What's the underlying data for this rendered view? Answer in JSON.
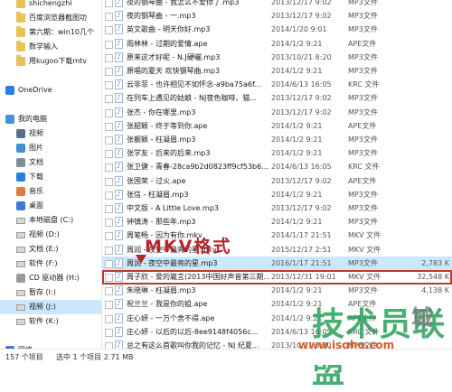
{
  "sidebar": {
    "items": [
      {
        "label": "shichengzhi",
        "kind": "folder",
        "indent": 1
      },
      {
        "label": "百度浏览器截图功",
        "kind": "folder",
        "indent": 1
      },
      {
        "label": "第六期：win10几个",
        "kind": "folder",
        "indent": 1
      },
      {
        "label": "数学输入",
        "kind": "folder",
        "indent": 1
      },
      {
        "label": "用kugoo下载mtv",
        "kind": "folder",
        "indent": 1
      },
      {
        "label": "",
        "kind": "spacer",
        "indent": 0
      },
      {
        "label": "OneDrive",
        "kind": "cloud",
        "indent": 0
      },
      {
        "label": "",
        "kind": "spacer",
        "indent": 0
      },
      {
        "label": "我的电脑",
        "kind": "pc",
        "indent": 0
      },
      {
        "label": "视频",
        "kind": "video",
        "indent": 1
      },
      {
        "label": "图片",
        "kind": "image",
        "indent": 1
      },
      {
        "label": "文档",
        "kind": "doc",
        "indent": 1
      },
      {
        "label": "下载",
        "kind": "download",
        "indent": 1
      },
      {
        "label": "音乐",
        "kind": "music",
        "indent": 1
      },
      {
        "label": "桌面",
        "kind": "desktop",
        "indent": 1
      },
      {
        "label": "本地磁盘 (C:)",
        "kind": "drive",
        "indent": 1
      },
      {
        "label": "视频 (D:)",
        "kind": "drive",
        "indent": 1
      },
      {
        "label": "文档 (E:)",
        "kind": "drive",
        "indent": 1
      },
      {
        "label": "软件 (F:)",
        "kind": "drive",
        "indent": 1
      },
      {
        "label": "CD 驱动器 (H:)",
        "kind": "cd",
        "indent": 1
      },
      {
        "label": "暂存 (I:)",
        "kind": "drive",
        "indent": 1
      },
      {
        "label": "视频 (J:)",
        "kind": "drive",
        "indent": 1,
        "selected": true
      },
      {
        "label": "软件 (K:)",
        "kind": "drive",
        "indent": 1
      },
      {
        "label": "",
        "kind": "spacer",
        "indent": 0
      },
      {
        "label": "网络",
        "kind": "network",
        "indent": 0
      }
    ]
  },
  "files": [
    {
      "name": "夜的钢琴曲 - 我怎么不爱你了.mp3",
      "date": "2013/12/17 9:02",
      "type": "MP3文件",
      "size": ""
    },
    {
      "name": "夜的钢琴曲 - 一.mp3",
      "date": "2013/12/17 9:02",
      "type": "MP3文件",
      "size": ""
    },
    {
      "name": "英文歌曲 - 明天你好.mp3",
      "date": "2014/1/20 9:01",
      "type": "MP3文件",
      "size": ""
    },
    {
      "name": "雨林林 - 过期的爱情.ape",
      "date": "2014/1/2 9:21",
      "type": "APE文件",
      "size": ""
    },
    {
      "name": "原来这才好呢 - N.J硬曬.mp3",
      "date": "2013/10/21 8:20",
      "type": "MP3文件",
      "size": ""
    },
    {
      "name": "原唱的夏天 欢快钢琴曲.mp3",
      "date": "2014/1/2 9:21",
      "type": "MP3文件",
      "size": ""
    },
    {
      "name": "云非菲 - 也许相见不如怀念-a9ba75a6f...",
      "date": "2014/6/13 16:05",
      "type": "KRC 文件",
      "size": ""
    },
    {
      "name": "在列车上遇见的姑娘 - NJ夜色咖啡、猫...",
      "date": "2013/12/17 9:02",
      "type": "MP3文件",
      "size": ""
    },
    {
      "name": "张杰 - 你在哪里.mp3",
      "date": "2013/12/17 9:02",
      "type": "MP3文件",
      "size": ""
    },
    {
      "name": "张韶颖 - 终于等到你.ape",
      "date": "2014/1/2 9:21",
      "type": "APE文件",
      "size": ""
    },
    {
      "name": "张靓颖 - 枉凝眉.mp3",
      "date": "2014/1/2 9:21",
      "type": "MP3文件",
      "size": ""
    },
    {
      "name": "张学友 - 后来的后来.mp3",
      "date": "2014/1/2 9:21",
      "type": "MP3文件",
      "size": ""
    },
    {
      "name": "张卫健 - 青春-28ca9b2d0823ff9cf53b6...",
      "date": "2014/6/13 16:05",
      "type": "KRC 文件",
      "size": ""
    },
    {
      "name": "张国荣 - 过火.ape",
      "date": "2013/12/17 9:02",
      "type": "APE文件",
      "size": ""
    },
    {
      "name": "张信 - 枉凝眉.mp3",
      "date": "2014/1/2 9:21",
      "type": "MP3文件",
      "size": ""
    },
    {
      "name": "中文版 - A Little Love.mp3",
      "date": "2013/12/17 9:02",
      "type": "MP3文件",
      "size": ""
    },
    {
      "name": "钟镇涛 - 那些年.mp3",
      "date": "2014/1/2 9:21",
      "type": "MP3文件",
      "size": ""
    },
    {
      "name": "周笔畅 - 因为有你.mkv",
      "date": "2014/1/17 21:51",
      "type": "MKV 文件",
      "size": ""
    },
    {
      "name": "周润 - 夜空中最亮的星.mkv",
      "date": "2015/12/17 2:51",
      "type": "MKV 文件",
      "size": ""
    },
    {
      "name": "周润 - 夜空中最亮的星.mp3",
      "date": "2016/1/17 21:51",
      "type": "MP3文件",
      "size": "2,783 K",
      "selected": true
    },
    {
      "name": "周子欣 - 爱的箴言(2013中国好声音第三期...",
      "date": "2013/12/31 19:01",
      "type": "MKV 文件",
      "size": "32,548 K",
      "highlighted": true
    },
    {
      "name": "朱晓琳 - 枉凝眉.mp3",
      "date": "2014/1/2 9:21",
      "type": "MP3文件",
      "size": "4,138 K"
    },
    {
      "name": "祝兰兰 - 我是你的姐.ape",
      "date": "2014/1/2 9:21",
      "type": "APE文件",
      "size": ""
    },
    {
      "name": "庄心妍 - 一万个舍不得.ape",
      "date": "2014/1/2 9:21",
      "type": "APE文件",
      "size": ""
    },
    {
      "name": "庄心妍 - 以后的以后-8ee9148f4056c...",
      "date": "2014/6/13 16:05",
      "type": "KRC 文件",
      "size": ""
    },
    {
      "name": "总之有这么首歌叫你我的记忆 - NJ 纪夏...",
      "date": "2013/10/21 8:20",
      "type": "MP3文件",
      "size": ""
    }
  ],
  "annotation": {
    "label": "MKV格式"
  },
  "watermark": {
    "main": "技术员联盟",
    "url": "www.jsgho.com",
    "logo": "城"
  },
  "status": {
    "count": "157 个项目",
    "selection": "选中 1 个项目  2.71 MB"
  }
}
